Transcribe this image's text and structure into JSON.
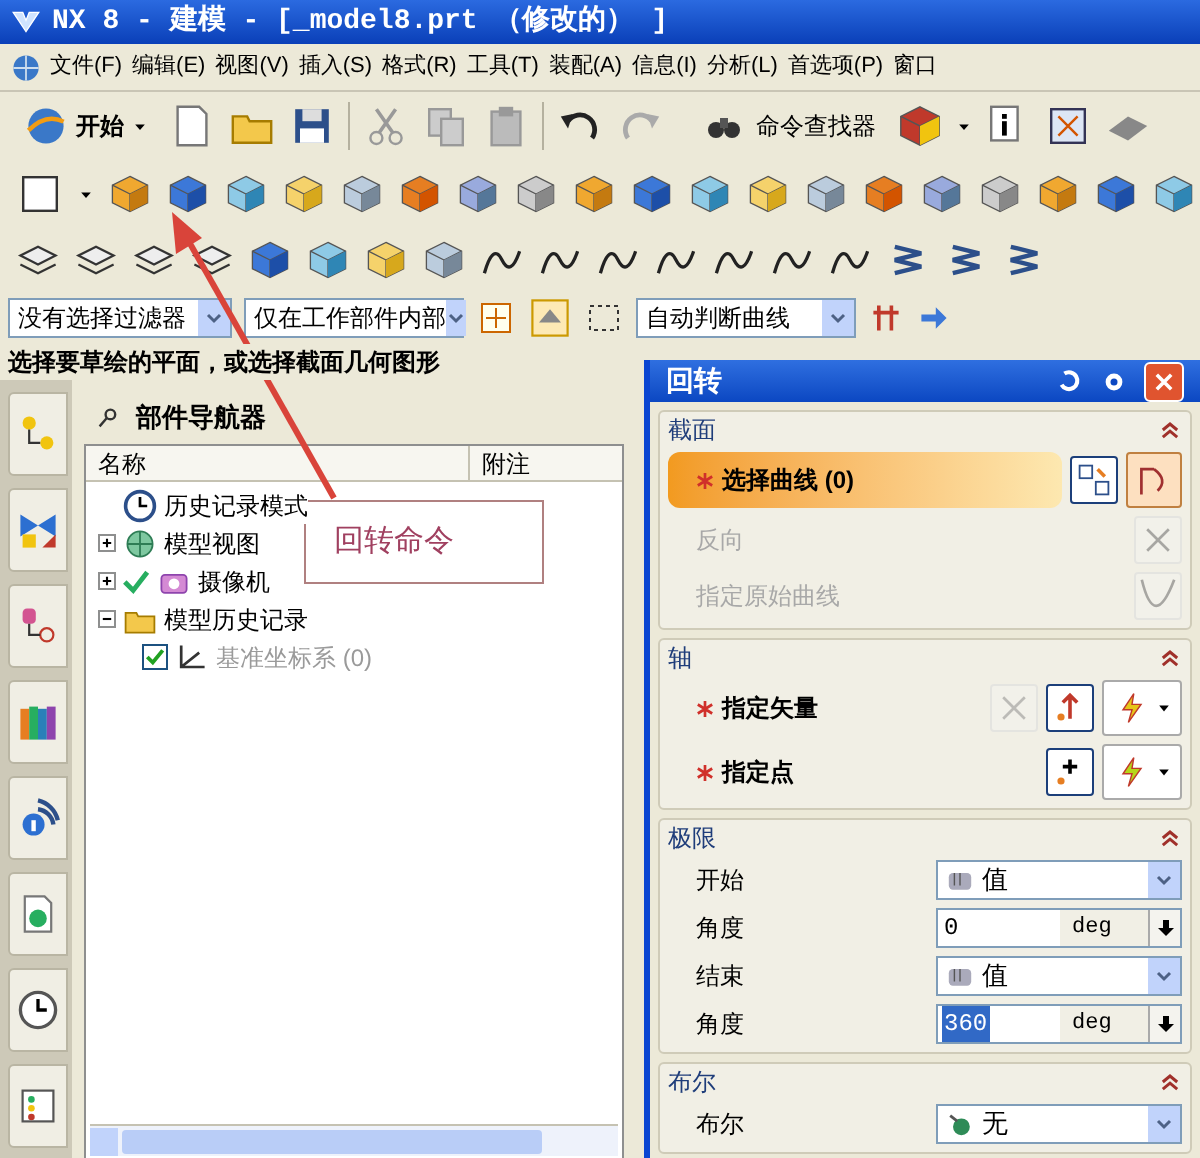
{
  "window": {
    "title": "NX 8 - 建模 - [_model8.prt （修改的） ]"
  },
  "menu": [
    {
      "label": "文件(F)"
    },
    {
      "label": "编辑(E)"
    },
    {
      "label": "视图(V)"
    },
    {
      "label": "插入(S)"
    },
    {
      "label": "格式(R)"
    },
    {
      "label": "工具(T)"
    },
    {
      "label": "装配(A)"
    },
    {
      "label": "信息(I)"
    },
    {
      "label": "分析(L)"
    },
    {
      "label": "首选项(P)"
    },
    {
      "label": "窗口"
    }
  ],
  "toolbar": {
    "start_button": "开始",
    "command_finder": "命令查找器"
  },
  "filter_bar": {
    "type_filter": "没有选择过滤器",
    "scope": "仅在工作部件内部",
    "curve_rule": "自动判断曲线"
  },
  "cue_line": "选择要草绘的平面，或选择截面几何图形",
  "part_navigator": {
    "title": "部件导航器",
    "columns": [
      "名称",
      "附注"
    ],
    "tree": [
      {
        "kind": "mode",
        "label": "历史记录模式"
      },
      {
        "kind": "node",
        "label": "模型视图",
        "expanded": false
      },
      {
        "kind": "node",
        "label": "摄像机",
        "expanded": false
      },
      {
        "kind": "node",
        "label": "模型历史记录",
        "expanded": true,
        "children": [
          {
            "kind": "feature",
            "label": "基准坐标系 (0)",
            "checked": true,
            "disabled": true
          }
        ]
      }
    ]
  },
  "annotation": {
    "text": "回转命令"
  },
  "dialog": {
    "title": "回转",
    "sections": [
      {
        "title": "截面",
        "expanded": true,
        "rows": [
          {
            "kind": "selection",
            "label": "选择曲线 (0)",
            "required": true,
            "selected": true,
            "disabled": false
          },
          {
            "kind": "action",
            "label": "反向",
            "disabled": true
          },
          {
            "kind": "action",
            "label": "指定原始曲线",
            "disabled": true
          }
        ]
      },
      {
        "title": "轴",
        "expanded": true,
        "rows": [
          {
            "kind": "selection",
            "label": "指定矢量",
            "required": true,
            "selected": false,
            "disabled": false
          },
          {
            "kind": "selection",
            "label": "指定点",
            "required": true,
            "selected": false,
            "disabled": false
          }
        ]
      },
      {
        "title": "极限",
        "expanded": true,
        "rows": [
          {
            "kind": "dropdown",
            "label": "开始",
            "value": "值"
          },
          {
            "kind": "number",
            "label": "角度",
            "value": "0",
            "unit": "deg",
            "highlighted": false
          },
          {
            "kind": "dropdown",
            "label": "结束",
            "value": "值"
          },
          {
            "kind": "number",
            "label": "角度",
            "value": "360",
            "unit": "deg",
            "highlighted": true
          }
        ]
      },
      {
        "title": "布尔",
        "expanded": true,
        "rows": [
          {
            "kind": "dropdown",
            "label": "布尔",
            "value": "无"
          }
        ]
      }
    ]
  }
}
